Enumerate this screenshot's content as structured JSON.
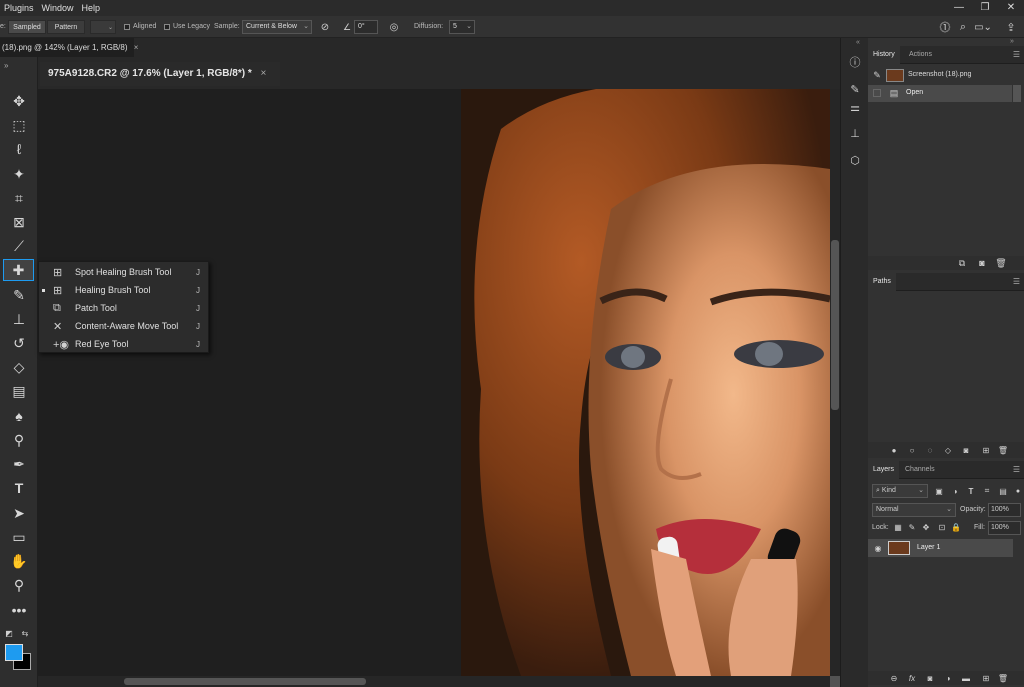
{
  "menubar": {
    "items": [
      "Plugins",
      "Window",
      "Help"
    ]
  },
  "options": {
    "mode_prefix": "e:",
    "sampled_label": "Sampled",
    "pattern_label": "Pattern",
    "aligned_label": "Aligned",
    "use_legacy_label": "Use Legacy",
    "sample_label": "Sample:",
    "sample_value": "Current & Below",
    "angle_value": "0°",
    "diffusion_label": "Diffusion:",
    "diffusion_value": "5"
  },
  "tabs": {
    "first": "(18).png @ 142% (Layer 1, RGB/8)",
    "active": "975A9128.CR2 @ 17.6% (Layer 1, RGB/8*) *",
    "close_glyph": "×"
  },
  "flyout": {
    "items": [
      {
        "label": "Spot Healing Brush Tool",
        "key": "J"
      },
      {
        "label": "Healing Brush Tool",
        "key": "J"
      },
      {
        "label": "Patch Tool",
        "key": "J"
      },
      {
        "label": "Content-Aware Move Tool",
        "key": "J"
      },
      {
        "label": "Red Eye Tool",
        "key": "J"
      }
    ]
  },
  "history": {
    "tab_label": "History",
    "actions_label": "Actions",
    "snapshot_label": "Screenshot (18).png",
    "open_label": "Open"
  },
  "paths": {
    "tab_label": "Paths"
  },
  "layers": {
    "tab_label": "Layers",
    "channels_label": "Channels",
    "kind_label": "Kind",
    "blend_mode": "Normal",
    "opacity_label": "Opacity:",
    "opacity_value": "100%",
    "lock_label": "Lock:",
    "fill_label": "Fill:",
    "fill_value": "100%",
    "layer_name": "Layer 1",
    "fx_label": "fx"
  },
  "colors": {
    "foreground": "#1e9bf0",
    "background": "#000000",
    "accent": "#1e9bf0"
  }
}
